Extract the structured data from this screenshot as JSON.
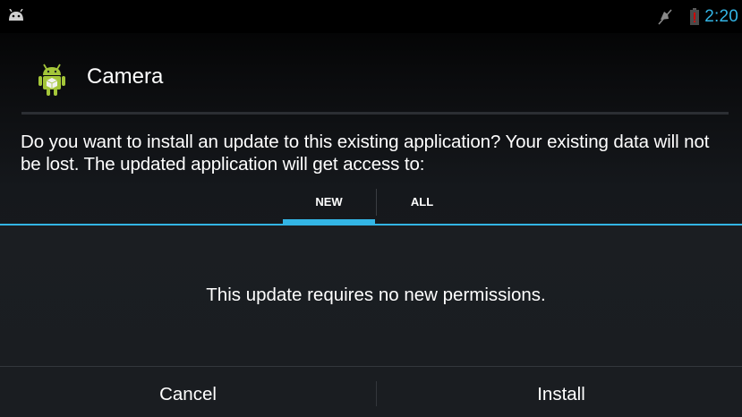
{
  "status_bar": {
    "left_icon": "android-notification-icon",
    "mute_icon": "muted-sound-icon",
    "battery_icon": "low-battery-icon",
    "time": "2:20",
    "time_color": "#33b5e5",
    "battery_alert_color": "#cc0000"
  },
  "dialog": {
    "app_icon": "android-app-icon",
    "app_name": "Camera",
    "message": "Do you want to install an update to this existing application? Your existing data will not be lost. The updated application will get access to:",
    "tabs": [
      {
        "label": "NEW",
        "selected": true
      },
      {
        "label": "ALL",
        "selected": false
      }
    ],
    "accent_color": "#33b5e5",
    "permissions_message": "This update requires no new permissions.",
    "buttons": {
      "cancel": "Cancel",
      "install": "Install"
    }
  }
}
